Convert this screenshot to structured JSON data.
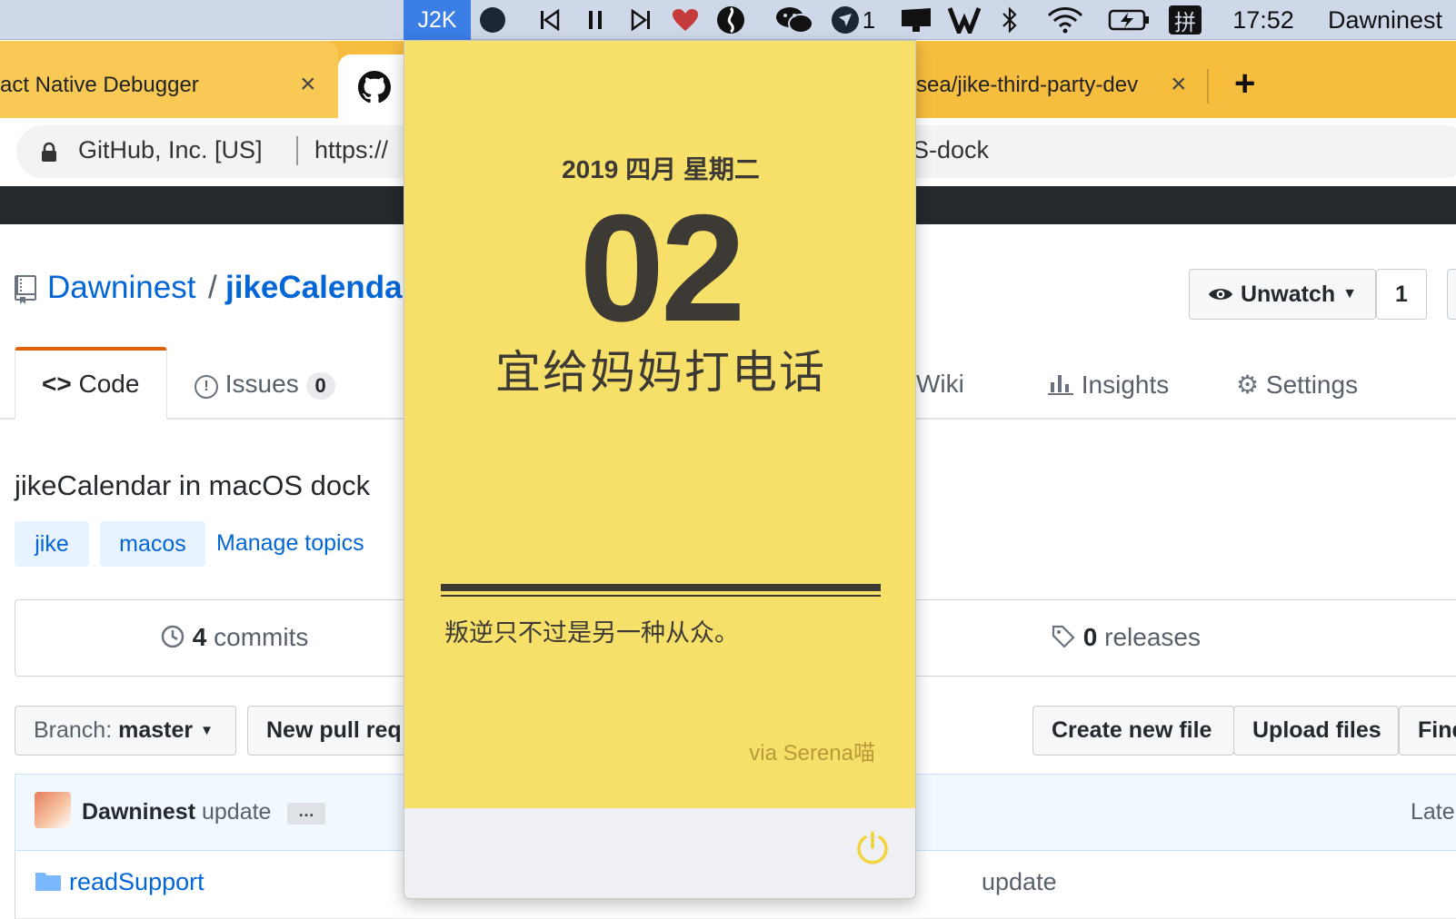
{
  "menubar": {
    "app_label": "J2K",
    "badge_count": "1",
    "input_method": "拼",
    "time": "17:52",
    "user": "Dawninest"
  },
  "browser": {
    "tab1_title": "act Native Debugger",
    "tab3_title": "sea/jike-third-party-dev",
    "address_org": "GitHub, Inc. [US]",
    "address_url_start": "https://",
    "address_url_end": "S-dock"
  },
  "github": {
    "owner": "Dawninest",
    "separator": "/",
    "repo": "jikeCalenda",
    "unwatch_label": "Unwatch",
    "watch_count": "1",
    "tabs": [
      {
        "label": "Code"
      },
      {
        "label": "Issues",
        "count": "0"
      },
      {
        "label": "Wiki"
      },
      {
        "label": "Insights"
      },
      {
        "label": "Settings"
      }
    ],
    "description": "jikeCalendar in macOS dock",
    "topics": [
      "jike",
      "macos"
    ],
    "manage_topics": "Manage topics",
    "commits_count": "4",
    "commits_label": "commits",
    "releases_count": "0",
    "releases_label": "releases",
    "branch_label": "Branch:",
    "branch_value": "master",
    "new_pull_label": "New pull req",
    "create_file_label": "Create new file",
    "upload_label": "Upload files",
    "find_label": "Find",
    "commit_author": "Dawninest",
    "commit_message": "update",
    "latest_label": "Late",
    "file_name": "readSupport",
    "file_message": "update"
  },
  "calendar": {
    "date_line": "2019 四月 星期二",
    "day": "02",
    "todo": "宜给妈妈打电话",
    "quote": "叛逆只不过是另一种从众。",
    "via": "via Serena喵"
  },
  "colors": {
    "card_yellow": "#f6e06a",
    "text_dark": "#3d3a35",
    "power_icon": "#f2d43a",
    "github_link": "#0366d6",
    "tab_strip": "#f6bd3f"
  }
}
